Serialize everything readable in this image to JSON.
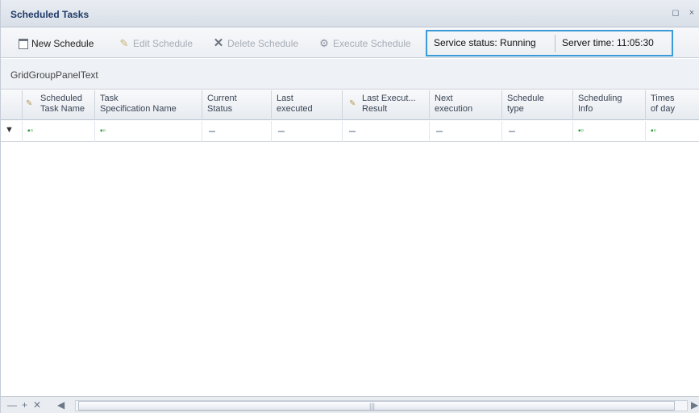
{
  "window": {
    "title": "Scheduled Tasks",
    "restore_glyph": "◻",
    "close_glyph": "×"
  },
  "toolbar": {
    "new_schedule": "New Schedule",
    "edit_schedule": "Edit Schedule",
    "delete_schedule": "Delete Schedule",
    "execute_schedule": "Execute Schedule",
    "icons": {
      "new": "new-document-icon",
      "edit": "pencil-icon",
      "delete": "delete-x-icon",
      "execute": "execute-icon"
    }
  },
  "status": {
    "service_status": "Service status: Running",
    "server_time": "Server time: 11:05:30",
    "highlight_color": "#3b9bd8"
  },
  "group_panel": {
    "text": "GridGroupPanelText"
  },
  "grid": {
    "columns": [
      {
        "label_line1": "Scheduled",
        "label_line2": "Task Name",
        "editable": true
      },
      {
        "label_line1": "Task",
        "label_line2": "Specification Name",
        "editable": false
      },
      {
        "label_line1": "Current",
        "label_line2": "Status",
        "editable": false
      },
      {
        "label_line1": "Last",
        "label_line2": "executed",
        "editable": false
      },
      {
        "label_line1": "Last Execut...",
        "label_line2": "Result",
        "editable": true
      },
      {
        "label_line1": "Next",
        "label_line2": "execution",
        "editable": false
      },
      {
        "label_line1": "Schedule",
        "label_line2": "type",
        "editable": false
      },
      {
        "label_line1": "Scheduling",
        "label_line2": "Info",
        "editable": false
      },
      {
        "label_line1": "Times",
        "label_line2": "of day",
        "editable": false
      }
    ],
    "filter_row": {
      "funnel_glyph": "▼",
      "cells": [
        "filter",
        "filter",
        "dash",
        "dash",
        "dash",
        "dash",
        "dash",
        "filter",
        "filter"
      ]
    }
  },
  "scrollbar": {
    "nav_first": "—",
    "nav_add": "+",
    "nav_delete": "✕",
    "nav_left": "◀",
    "nav_right": "▶",
    "grip": "|||"
  }
}
